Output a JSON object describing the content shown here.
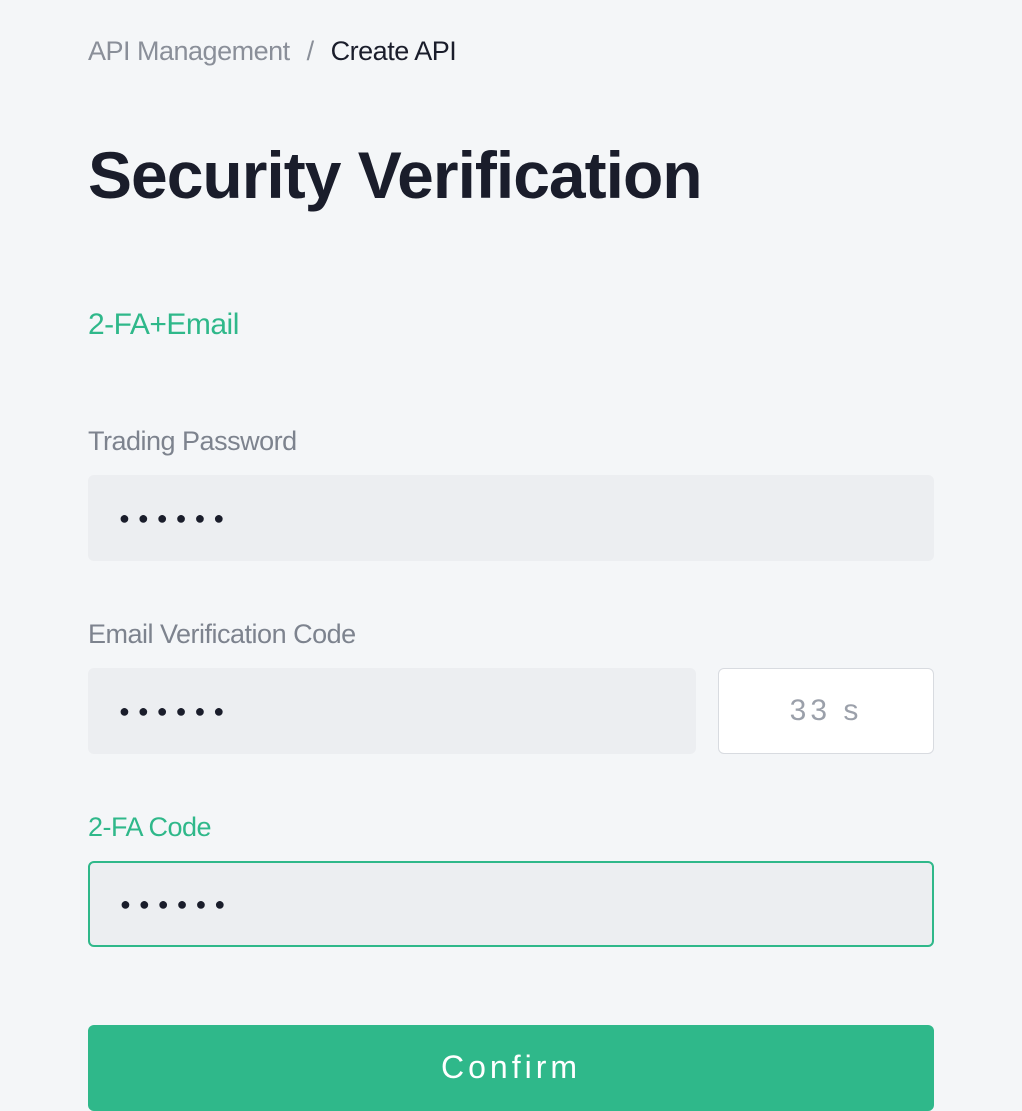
{
  "breadcrumb": {
    "prev": "API Management",
    "separator": "/",
    "current": "Create API"
  },
  "page_title": "Security Verification",
  "method": "2-FA+Email",
  "fields": {
    "trading_password": {
      "label": "Trading Password",
      "value": "●●●●●●"
    },
    "email_code": {
      "label": "Email Verification Code",
      "value": "●●●●●●",
      "countdown": "33 s"
    },
    "twofa_code": {
      "label": "2-FA Code",
      "value": "●●●●●●"
    }
  },
  "confirm_label": "Confirm"
}
